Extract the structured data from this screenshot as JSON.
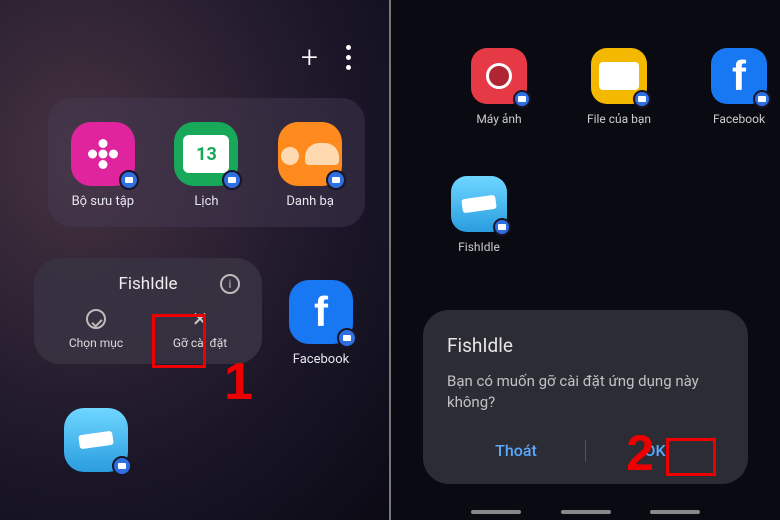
{
  "left": {
    "apps": [
      {
        "label": "Bộ sưu tập"
      },
      {
        "label": "Lịch",
        "day": "13"
      },
      {
        "label": "Danh bạ"
      }
    ],
    "contextMenu": {
      "title": "FishIdle",
      "actions": [
        {
          "label": "Chọn mục"
        },
        {
          "label": "Gỡ cài đặt"
        }
      ]
    },
    "facebook_label": "Facebook",
    "step": "1"
  },
  "right": {
    "apps": [
      {
        "label": "Máy ảnh"
      },
      {
        "label": "File của bạn"
      },
      {
        "label": "Facebook"
      },
      {
        "label": "FishIdle"
      }
    ],
    "dialog": {
      "title": "FishIdle",
      "message": "Bạn có muốn gỡ cài đặt ứng dụng này không?",
      "cancel": "Thoát",
      "ok": "OK"
    },
    "step": "2"
  }
}
